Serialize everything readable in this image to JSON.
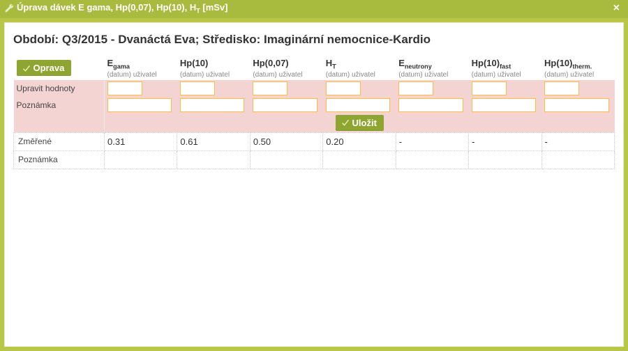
{
  "titlebar": {
    "text": "Úprava dávek E gama, Hp(0,07), Hp(10), H",
    "text_sub": "T",
    "text_tail": " [mSv]"
  },
  "page_title": "Období: Q3/2015 - Dvanáctá Eva; Středisko: Imaginární nemocnice-Kardio",
  "buttons": {
    "oprava": "Oprava",
    "ulozit": "Uložit"
  },
  "rowlabels": {
    "upravit": "Upravit hodnoty",
    "poznamka1": "Poznámka",
    "zmerene": "Změřené",
    "poznamka2": "Poznámka"
  },
  "col_sub": "(datum) uživatel",
  "columns": [
    {
      "title_pre": "E",
      "title_sub": "gama"
    },
    {
      "title_pre": "Hp(10)",
      "title_sub": ""
    },
    {
      "title_pre": "Hp(0,07)",
      "title_sub": ""
    },
    {
      "title_pre": "H",
      "title_sub": "T"
    },
    {
      "title_pre": "E",
      "title_sub": "neutrony"
    },
    {
      "title_pre": "Hp(10)",
      "title_sub": "fast"
    },
    {
      "title_pre": "Hp(10)",
      "title_sub": "therm."
    }
  ],
  "inputs": {
    "upravit": [
      "",
      "",
      "",
      "",
      "",
      "",
      ""
    ],
    "poznamka": [
      "",
      "",
      "",
      "",
      "",
      "",
      ""
    ]
  },
  "measured": [
    "0.31",
    "0.61",
    "0.50",
    "0.20",
    "-",
    "-",
    "-"
  ],
  "notes": [
    "",
    "",
    "",
    "",
    "",
    "",
    ""
  ]
}
